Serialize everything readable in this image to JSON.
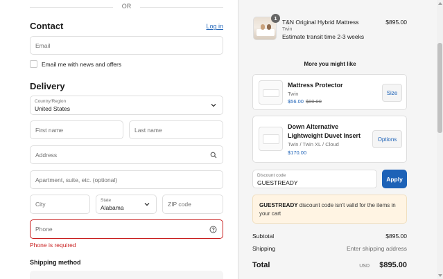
{
  "divider": {
    "text": "OR"
  },
  "contact": {
    "title": "Contact",
    "login_link": "Log in",
    "email_placeholder": "Email",
    "newsletter_label": "Email me with news and offers",
    "newsletter_checked": false
  },
  "delivery": {
    "title": "Delivery",
    "country_label": "Country/Region",
    "country_value": "United States",
    "first_name_placeholder": "First name",
    "last_name_placeholder": "Last name",
    "address_placeholder": "Address",
    "apartment_placeholder": "Apartment, suite, etc. (optional)",
    "city_placeholder": "City",
    "state_label": "State",
    "state_value": "Alabama",
    "zip_placeholder": "ZIP code",
    "phone_placeholder": "Phone",
    "phone_error": "Phone is required"
  },
  "shipping_method": {
    "title": "Shipping method"
  },
  "order": {
    "item": {
      "quantity": "1",
      "name": "T&N Original Hybrid Mattress",
      "variant": "Twin",
      "eta": "Estimate transit time 2-3 weeks",
      "price": "$895.00"
    },
    "recommendations_title": "More you might like",
    "recommendations": [
      {
        "name": "Mattress Protector",
        "variant": "Twin",
        "price": "$56.00",
        "compare_price": "$80.00",
        "button": "Size"
      },
      {
        "name_line1": "Down Alternative",
        "name_line2": "Lightweight Duvet Insert",
        "variant": "Twin / Twin XL / Cloud",
        "price": "$170.00",
        "button": "Options"
      }
    ],
    "discount": {
      "label": "Discount code",
      "value": "GUESTREADY",
      "apply": "Apply",
      "notice_code": "GUESTREADY",
      "notice_text": " discount code isn't valid for the items in your cart"
    },
    "summary": {
      "subtotal_label": "Subtotal",
      "subtotal_value": "$895.00",
      "shipping_label": "Shipping",
      "shipping_value": "Enter shipping address",
      "total_label": "Total",
      "currency": "USD",
      "total_value": "$895.00"
    }
  },
  "colors": {
    "accent": "#1d62b7",
    "error": "#c81e1e",
    "notice_bg": "#fff4e3",
    "summary_bg": "#f5f5f5"
  }
}
